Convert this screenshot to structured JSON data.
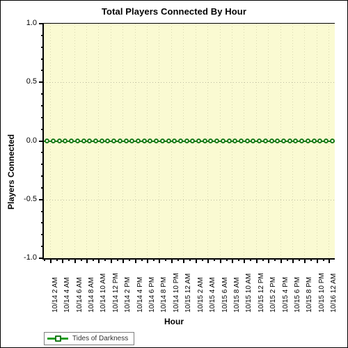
{
  "chart_data": {
    "type": "line",
    "title": "Total Players Connected By Hour",
    "xlabel": "Hour",
    "ylabel": "Players Connected",
    "ylim": [
      -1.0,
      1.0
    ],
    "ytick_labels": [
      "1.0",
      "0.5",
      "0.0",
      "-0.5",
      "-1.0"
    ],
    "ytick_values": [
      1.0,
      0.5,
      0.0,
      -0.5,
      -1.0
    ],
    "grid": true,
    "legend_position": "bottom-left",
    "categories": [
      "10/14 2 AM",
      "10/14 4 AM",
      "10/14 6 AM",
      "10/14 8 AM",
      "10/14 10 AM",
      "10/14 12 PM",
      "10/14 2 PM",
      "10/14 4 PM",
      "10/14 6 PM",
      "10/14 8 PM",
      "10/14 10 PM",
      "10/15 12 AM",
      "10/15 2 AM",
      "10/15 4 AM",
      "10/15 6 AM",
      "10/15 8 AM",
      "10/15 10 AM",
      "10/15 12 PM",
      "10/15 2 PM",
      "10/15 4 PM",
      "10/15 6 PM",
      "10/15 8 PM",
      "10/15 10 PM",
      "10/16 12 AM"
    ],
    "series": [
      {
        "name": "Tides of Darkness",
        "color": "#1a7a1a",
        "values": [
          0,
          0,
          0,
          0,
          0,
          0,
          0,
          0,
          0,
          0,
          0,
          0,
          0,
          0,
          0,
          0,
          0,
          0,
          0,
          0,
          0,
          0,
          0,
          0,
          0,
          0,
          0,
          0,
          0,
          0,
          0,
          0,
          0,
          0,
          0,
          0,
          0,
          0,
          0,
          0,
          0,
          0,
          0,
          0,
          0,
          0,
          0,
          0
        ]
      }
    ]
  },
  "legend": {
    "entries": [
      {
        "label": "Tides of Darkness"
      }
    ]
  },
  "colors": {
    "plot_background": "#FAFAD2",
    "series_green": "#1A7A1A",
    "axis_black": "#000000",
    "page_background": "#FFFFFF"
  }
}
